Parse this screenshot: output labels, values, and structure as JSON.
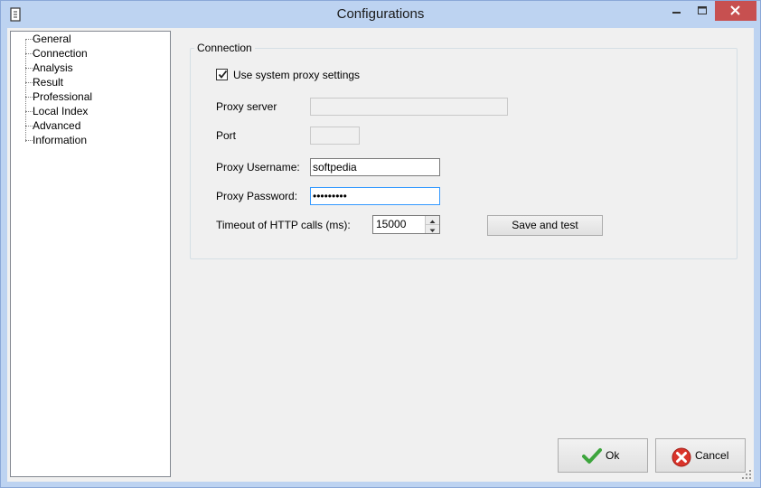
{
  "window": {
    "title": "Configurations"
  },
  "tree": {
    "items": [
      "General",
      "Connection",
      "Analysis",
      "Result",
      "Professional",
      "Local Index",
      "Advanced",
      "Information"
    ]
  },
  "connection": {
    "group_title": "Connection",
    "use_system_proxy_label": "Use system proxy settings",
    "use_system_proxy_checked": true,
    "proxy_server_label": "Proxy server",
    "proxy_server_value": "",
    "port_label": "Port",
    "port_value": "",
    "proxy_username_label": "Proxy Username:",
    "proxy_username_value": "softpedia",
    "proxy_password_label": "Proxy Password:",
    "proxy_password_value": "softpedia",
    "timeout_label": "Timeout of HTTP calls (ms):",
    "timeout_value": "15000",
    "save_test_label": "Save and test"
  },
  "footer": {
    "ok_label": "Ok",
    "cancel_label": "Cancel"
  },
  "colors": {
    "titlebar": "#bdd3f1",
    "close": "#c75050",
    "ok_check": "#3da53d",
    "cancel_red": "#d9342b"
  },
  "icons": {
    "app": "document-icon",
    "minimize": "minimize-icon",
    "maximize": "maximize-icon",
    "close": "close-icon",
    "checkbox": "checkmark-icon",
    "ok": "checkmark-icon",
    "cancel": "cancel-x-icon",
    "spin_up": "arrow-up-icon",
    "spin_down": "arrow-down-icon",
    "grip": "resize-grip-icon"
  }
}
